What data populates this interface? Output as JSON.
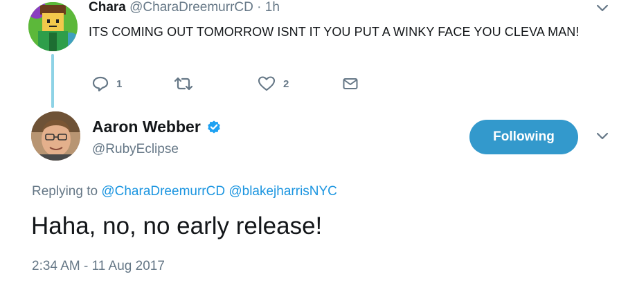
{
  "parent_tweet": {
    "name": "Chara",
    "handle": "@CharaDreemurrCD",
    "separator": "·",
    "time": "1h",
    "text": "ITS COMING OUT TOMORROW ISNT IT YOU PUT A WINKY FACE YOU CLEVA MAN!",
    "actions": {
      "reply_icon": "reply-icon",
      "reply_count": "1",
      "retweet_icon": "retweet-icon",
      "like_icon": "heart-icon",
      "like_count": "2",
      "dm_icon": "envelope-icon"
    }
  },
  "main_tweet": {
    "name": "Aaron Webber",
    "verified_icon": "verified-badge-icon",
    "handle": "@RubyEclipse",
    "follow_label": "Following",
    "replying_prefix": "Replying to",
    "replying_to": [
      "@CharaDreemurrCD",
      "@blakejharrisNYC"
    ],
    "text": "Haha, no, no early release!",
    "timestamp": "2:34 AM - 11 Aug 2017"
  },
  "colors": {
    "accent": "#1b95e0",
    "follow_button": "#3399cc",
    "thread_line": "#8ed3e6",
    "muted": "#657786",
    "text": "#14171a"
  }
}
